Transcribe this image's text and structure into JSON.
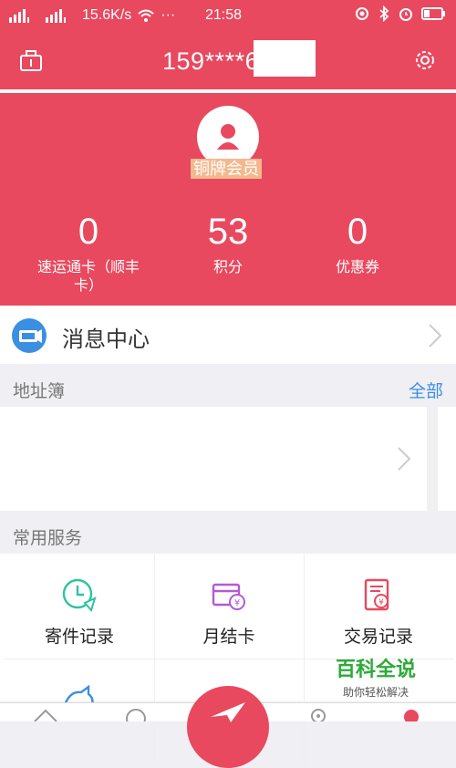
{
  "status_bar": {
    "speed": "15.6K/s",
    "dots": "···",
    "time": "21:58"
  },
  "header": {
    "phone": "159****6"
  },
  "profile": {
    "badge": "铜牌会员",
    "stats": [
      {
        "value": "0",
        "label": "速运通卡（顺丰卡）"
      },
      {
        "value": "53",
        "label": "积分"
      },
      {
        "value": "0",
        "label": "优惠券"
      }
    ]
  },
  "message_center": {
    "label": "消息中心"
  },
  "address_book": {
    "title": "地址簿",
    "link": "全部"
  },
  "services": {
    "title": "常用服务",
    "items": [
      {
        "label": "寄件记录",
        "icon": "clock-send-icon"
      },
      {
        "label": "月结卡",
        "icon": "card-yen-icon"
      },
      {
        "label": "交易记录",
        "icon": "receipt-yen-icon"
      }
    ]
  },
  "watermark": {
    "title": "百科全说",
    "subtitle": "助你轻松解决"
  },
  "colors": {
    "brand": "#e8495f",
    "link": "#3b8fe3"
  }
}
